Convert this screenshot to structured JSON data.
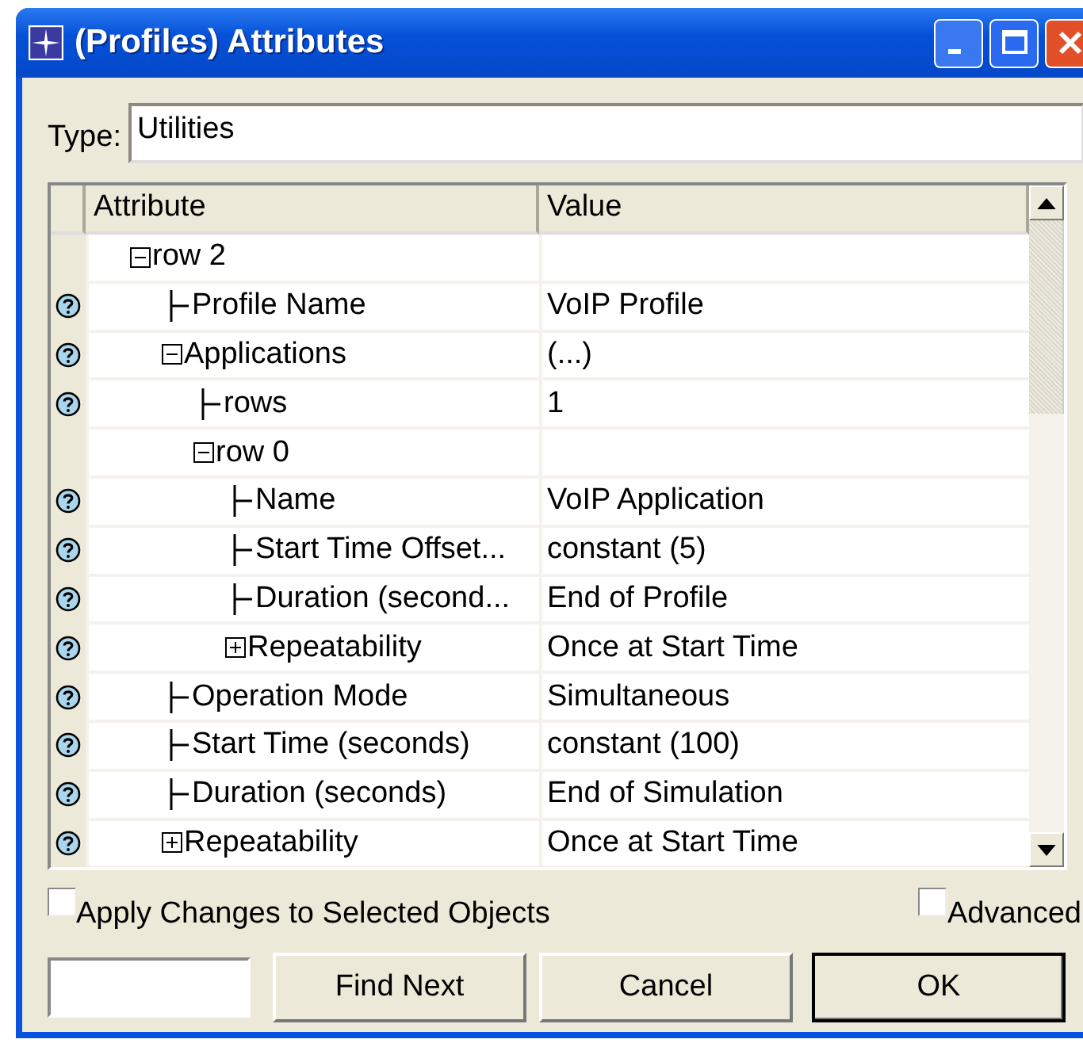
{
  "window": {
    "title": "(Profiles) Attributes"
  },
  "type_field": {
    "label": "Type:",
    "value": "Utilities"
  },
  "table": {
    "columns": [
      "Attribute",
      "Value"
    ],
    "tree": [
      {
        "kind": "group",
        "label": "row 2",
        "help": false,
        "expanded": true,
        "children": [
          {
            "kind": "leaf",
            "label": "Profile Name",
            "value": "VoIP Profile",
            "help": true
          },
          {
            "kind": "group",
            "label": "Applications",
            "value": "(...)",
            "help": true,
            "expanded": true,
            "children": [
              {
                "kind": "leaf",
                "label": "rows",
                "value": "1",
                "help": true
              },
              {
                "kind": "group",
                "label": "row 0",
                "help": false,
                "expanded": true,
                "children": [
                  {
                    "kind": "leaf",
                    "label": "Name",
                    "value": "VoIP Application",
                    "help": true
                  },
                  {
                    "kind": "leaf",
                    "label": "Start Time Offset...",
                    "value": "constant (5)",
                    "help": true
                  },
                  {
                    "kind": "leaf",
                    "label": "Duration (second...",
                    "value": "End of Profile",
                    "help": true
                  },
                  {
                    "kind": "group",
                    "label": "Repeatability",
                    "value": "Once at Start Time",
                    "help": true,
                    "expanded": false
                  }
                ]
              }
            ]
          },
          {
            "kind": "leaf",
            "label": "Operation Mode",
            "value": "Simultaneous",
            "help": true
          },
          {
            "kind": "leaf",
            "label": "Start Time (seconds)",
            "value": "constant (100)",
            "help": true
          },
          {
            "kind": "leaf",
            "label": "Duration (seconds)",
            "value": "End of Simulation",
            "help": true
          },
          {
            "kind": "group",
            "label": "Repeatability",
            "value": "Once at Start Time",
            "help": true,
            "expanded": false
          }
        ]
      }
    ]
  },
  "options": [
    {
      "label": "Apply Changes to Selected Objects",
      "checked": false
    },
    {
      "label": "Advanced",
      "checked": false
    }
  ],
  "buttons": [
    {
      "label": "Find Next",
      "default": false
    },
    {
      "label": "Cancel",
      "default": false
    },
    {
      "label": "OK",
      "default": true
    }
  ]
}
